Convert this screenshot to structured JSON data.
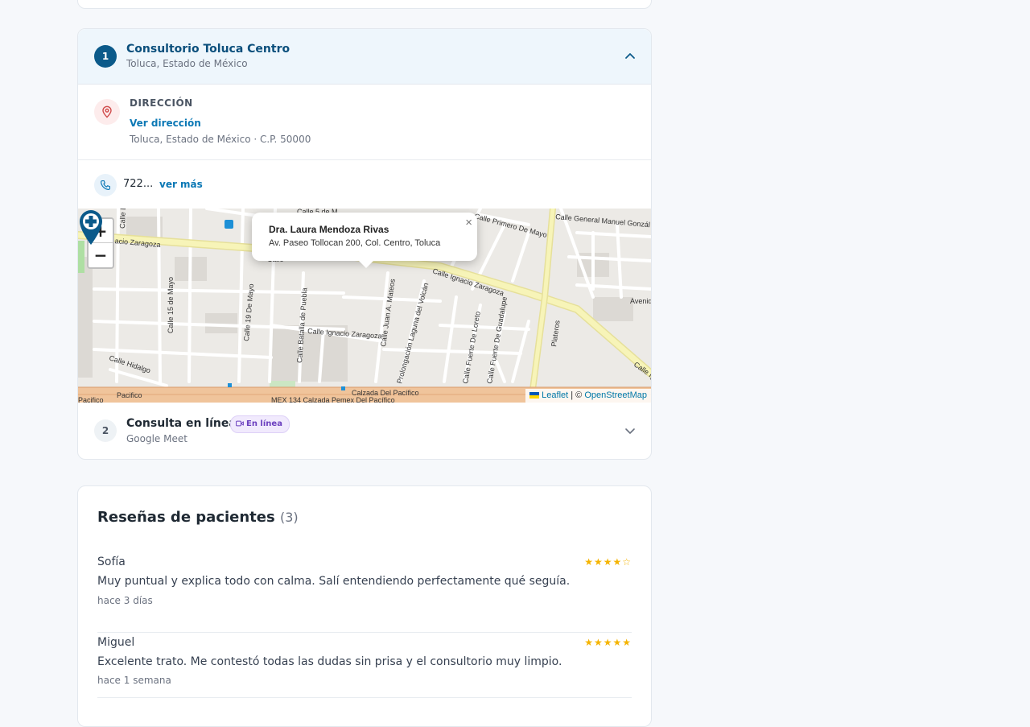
{
  "locations": [
    {
      "number": "1",
      "title": "Consultorio Toluca Centro",
      "subtitle": "Toluca, Estado de México",
      "address_label": "DIRECCIÓN",
      "address_link": "Ver dirección",
      "address_city": "Toluca, Estado de México · C.P. 50000",
      "phone": "722...",
      "phone_more": "ver más"
    },
    {
      "number": "2",
      "title": "Consulta en línea",
      "badge": "En línea",
      "subtitle": "Google Meet"
    }
  ],
  "map": {
    "zoom_in": "+",
    "zoom_out": "−",
    "popup_name": "Dra. Laura Mendoza Rivas",
    "popup_address": "Av. Paseo Tollocan 200, Col. Centro, Toluca",
    "popup_close": "×",
    "attribution_leaflet": "Leaflet",
    "attribution_sep": " | © ",
    "attribution_osm": "OpenStreetMap",
    "streets": [
      "Calle Ignacio Zaragoza",
      "Calle Ignacio Zaragoza",
      "Calle Ignacio Zaragoza",
      "Calle 15 de Mayo",
      "Calle 19 De Mayo",
      "Calle Batalla de Puebla",
      "Calle Juan A. Mateos",
      "Prolongación Laguna del Volcán",
      "Calle Fuerte De Loreto",
      "Calle Fuerte De Guadalupe",
      "Plateros",
      "Calle Primero De Mayo",
      "Calle General Manuel Gonzál",
      "Avenid",
      "Calle Hidalgo",
      "Calzada Del Pacífico",
      "MEX 134 Calzada Pemex Del Pacífico",
      "Calle 5 de M",
      "Calle L",
      "Calle",
      "Pacifico"
    ]
  },
  "reviews": {
    "title": "Reseñas de pacientes",
    "count": "(3)",
    "items": [
      {
        "name": "Sofía",
        "stars": "★★★★☆",
        "text": "Muy puntual y explica todo con calma. Salí entendiendo perfectamente qué seguía.",
        "time": "hace 3 días"
      },
      {
        "name": "Miguel",
        "stars": "★★★★★",
        "text": "Excelente trato. Me contestó todas las dudas sin prisa y el consultorio muy limpio.",
        "time": "hace 1 semana"
      }
    ]
  },
  "colors": {
    "accent": "#0b5a8a",
    "link": "#0b78b5",
    "star": "#f5b400",
    "badge": "#6b3fbf"
  }
}
